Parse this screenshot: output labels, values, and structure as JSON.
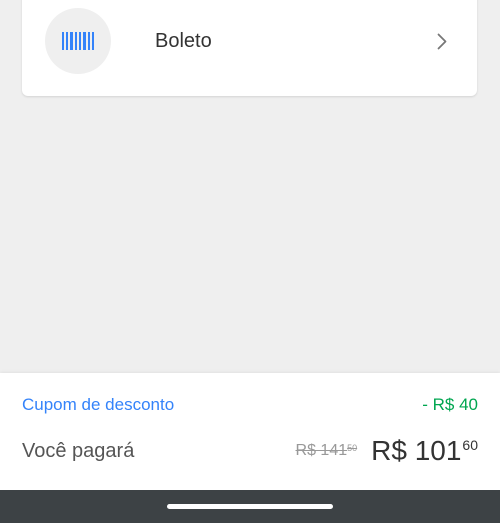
{
  "payment_method": {
    "label": "Boleto",
    "icon": "barcode-icon",
    "chevron_icon": "chevron-right-icon"
  },
  "summary": {
    "coupon_label": "Cupom de desconto",
    "coupon_value": "- R$ 40",
    "total_label": "Você pagará",
    "old_price_main": "R$ 141",
    "old_price_cents": "50",
    "new_price_main": "R$ 101",
    "new_price_cents": "60"
  },
  "colors": {
    "link_blue": "#3483fa",
    "discount_green": "#00a650",
    "nav_bar": "#3d4245"
  }
}
